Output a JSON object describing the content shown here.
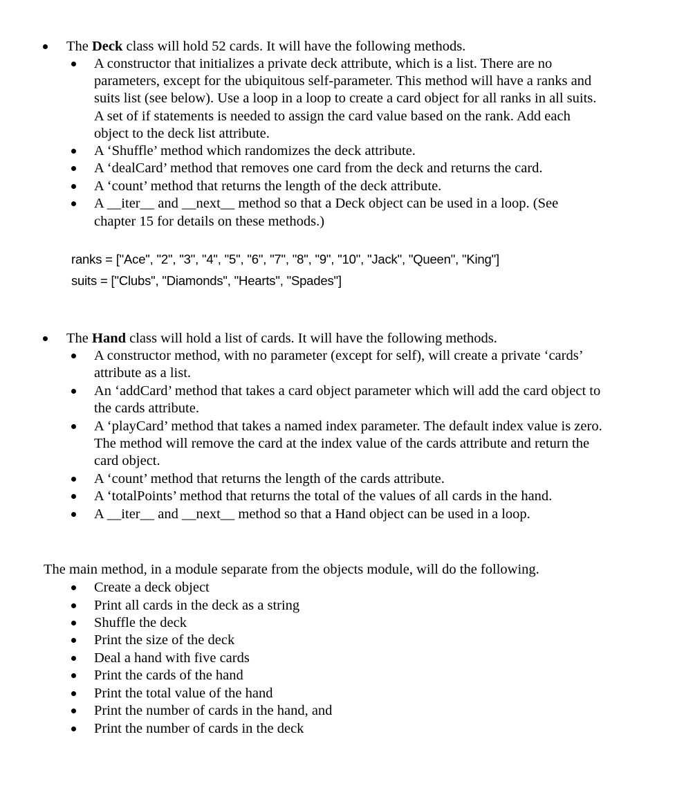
{
  "deck_section": {
    "intro_prefix": "The ",
    "intro_bold": "Deck",
    "intro_suffix": " class will hold 52 cards. It will have the following methods.",
    "items": [
      {
        "lines": [
          "A constructor that initializes a private deck attribute, which is a list. There are no",
          "parameters, except for the ubiquitous self-parameter. This method will have a ranks and",
          "suits list (see below). Use a loop in a loop to create a card object for all ranks in all suits.",
          "A set of if statements is needed to assign the card value based on the rank. Add each",
          "object to the deck list attribute."
        ]
      },
      {
        "lines": [
          "A ‘Shuffle’ method which randomizes the deck attribute."
        ]
      },
      {
        "lines": [
          "A ‘dealCard’ method that removes one card from the deck and returns the card."
        ]
      },
      {
        "lines": [
          "A ‘count’ method that returns the length of the deck attribute."
        ]
      },
      {
        "lines": [
          "A __iter__ and __next__ method so that a Deck object can be used in  a loop. (See",
          "chapter 15 for details on these methods.)"
        ]
      }
    ],
    "code": {
      "ranks": "ranks = [\"Ace\", \"2\", \"3\", \"4\", \"5\", \"6\", \"7\", \"8\", \"9\", \"10\", \"Jack\", \"Queen\", \"King\"]",
      "suits": "suits = [\"Clubs\", \"Diamonds\", \"Hearts\", \"Spades\"]"
    }
  },
  "hand_section": {
    "intro_prefix": "The ",
    "intro_bold": "Hand",
    "intro_suffix": " class will hold a list of cards. It will have the following methods.",
    "items": [
      {
        "lines": [
          "A constructor method, with no parameter (except for self), will create a private ‘cards’",
          "attribute as a list."
        ]
      },
      {
        "lines": [
          "An ‘addCard’ method that takes a card object parameter which will add the card object to",
          "the cards attribute."
        ]
      },
      {
        "lines": [
          "A ‘playCard’ method that takes a named index parameter. The default index value is zero.",
          "The method will remove the card at the index value of the cards attribute and return the",
          "card object."
        ]
      },
      {
        "lines": [
          "A ‘count’ method that returns the length of the cards attribute."
        ]
      },
      {
        "lines": [
          "A ‘totalPoints’ method that returns the total of the values of all cards in the hand."
        ]
      },
      {
        "lines": [
          "A __iter__ and __next__ method so that a Hand object can be used in  a loop."
        ]
      }
    ]
  },
  "main_section": {
    "intro": "The main method, in a module separate from the objects module, will do the following.",
    "items": [
      "Create a deck object",
      "Print all cards in the deck as a string",
      "Shuffle the deck",
      "Print the size of the deck",
      "Deal a hand with five cards",
      "Print the cards of the hand",
      "Print the total value of the hand",
      "Print the number of cards in the hand, and",
      "Print the number of cards in the deck"
    ]
  }
}
